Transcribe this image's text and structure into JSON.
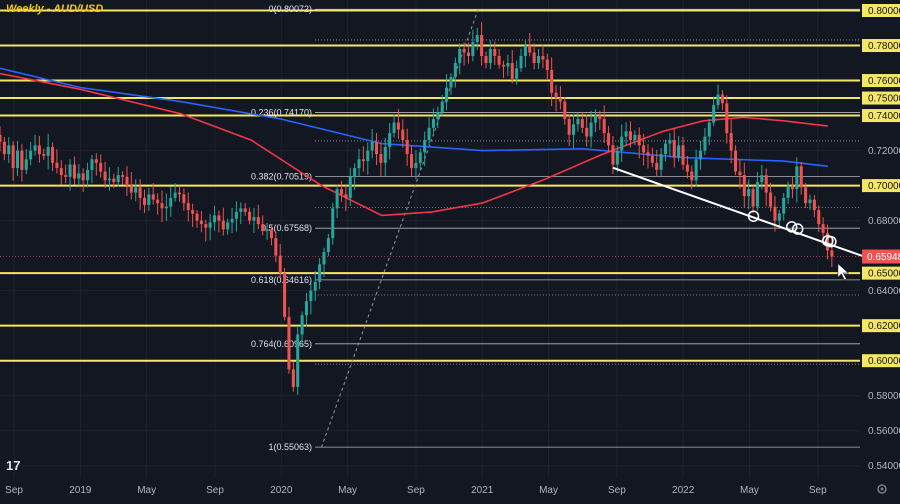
{
  "chart_data": {
    "type": "candlestick",
    "title": "Weekly - AUD/USD",
    "y_axis": {
      "ticks": [
        "0.80000",
        "0.78000",
        "0.76000",
        "0.75000",
        "0.74000",
        "0.72000",
        "0.70000",
        "0.68000",
        "0.65000",
        "0.64000",
        "0.62000",
        "0.60000",
        "0.58000",
        "0.56000",
        "0.54000"
      ],
      "tick_values": [
        0.8,
        0.78,
        0.76,
        0.75,
        0.74,
        0.72,
        0.7,
        0.68,
        0.65,
        0.64,
        0.62,
        0.6,
        0.58,
        0.56,
        0.54
      ],
      "range": [
        0.533,
        0.806
      ],
      "current_price_label": "0.65948",
      "current_price": 0.65948
    },
    "x_axis": {
      "ticks": [
        "Sep",
        "2019",
        "May",
        "Sep",
        "2020",
        "May",
        "Sep",
        "2021",
        "May",
        "Sep",
        "2022",
        "May",
        "Sep"
      ],
      "tick_dates": [
        2018.67,
        2019.0,
        2019.33,
        2019.67,
        2020.0,
        2020.33,
        2020.67,
        2021.0,
        2021.33,
        2021.67,
        2022.0,
        2022.33,
        2022.67
      ],
      "range": [
        2018.6,
        2022.88
      ]
    },
    "horizontal_levels": [
      0.8,
      0.78,
      0.76,
      0.75,
      0.74,
      0.7,
      0.65,
      0.62,
      0.6
    ],
    "level_color": "#f5e663",
    "fibonacci": [
      {
        "label": "0(0.80072)",
        "value": 0.80072
      },
      {
        "label": "0.236(0.74170)",
        "value": 0.7417
      },
      {
        "label": "0.382(0.70519)",
        "value": 0.70519
      },
      {
        "label": "0.5(0.67568)",
        "value": 0.67568
      },
      {
        "label": "0.618(0.64616)",
        "value": 0.64616
      },
      {
        "label": "0.764(0.60965)",
        "value": 0.60965
      },
      {
        "label": "1(0.55063)",
        "value": 0.55063
      }
    ],
    "dotted_levels": [
      0.7832,
      0.7255,
      0.6875,
      0.6375,
      0.598
    ],
    "moving_averages": [
      {
        "color": "#2962ff",
        "points": [
          [
            2018.6,
            0.767
          ],
          [
            2019.0,
            0.756
          ],
          [
            2019.5,
            0.748
          ],
          [
            2020.0,
            0.738
          ],
          [
            2020.5,
            0.724
          ],
          [
            2021.0,
            0.72
          ],
          [
            2021.5,
            0.721
          ],
          [
            2022.0,
            0.716
          ],
          [
            2022.5,
            0.714
          ],
          [
            2022.72,
            0.711
          ]
        ]
      },
      {
        "color": "#f23645",
        "points": [
          [
            2018.6,
            0.764
          ],
          [
            2019.0,
            0.755
          ],
          [
            2019.5,
            0.741
          ],
          [
            2019.85,
            0.726
          ],
          [
            2020.2,
            0.7
          ],
          [
            2020.5,
            0.683
          ],
          [
            2020.75,
            0.685
          ],
          [
            2021.0,
            0.69
          ],
          [
            2021.3,
            0.703
          ],
          [
            2021.6,
            0.718
          ],
          [
            2021.9,
            0.731
          ],
          [
            2022.1,
            0.737
          ],
          [
            2022.3,
            0.739
          ],
          [
            2022.5,
            0.737
          ],
          [
            2022.72,
            0.734
          ]
        ]
      }
    ],
    "trendline": {
      "color": "#ffffff",
      "points": [
        [
          2021.65,
          0.7102
        ],
        [
          2022.75,
          0.6618
        ]
      ],
      "touches": [
        [
          2022.35,
          0.6825
        ],
        [
          2022.54,
          0.6764
        ],
        [
          2022.57,
          0.6752
        ],
        [
          2022.72,
          0.6685
        ],
        [
          2022.735,
          0.668
        ]
      ]
    },
    "anchor_dashed": {
      "points": [
        [
          2020.2,
          0.5506
        ],
        [
          2020.98,
          0.8007
        ]
      ]
    },
    "candles_close": [
      0.725,
      0.718,
      0.723,
      0.71,
      0.72,
      0.709,
      0.715,
      0.72,
      0.723,
      0.718,
      0.717,
      0.722,
      0.713,
      0.71,
      0.706,
      0.705,
      0.712,
      0.704,
      0.707,
      0.703,
      0.709,
      0.715,
      0.713,
      0.708,
      0.703,
      0.704,
      0.702,
      0.706,
      0.705,
      0.7,
      0.696,
      0.699,
      0.693,
      0.689,
      0.695,
      0.692,
      0.69,
      0.687,
      0.688,
      0.693,
      0.696,
      0.695,
      0.69,
      0.686,
      0.684,
      0.68,
      0.678,
      0.676,
      0.679,
      0.683,
      0.68,
      0.675,
      0.679,
      0.681,
      0.685,
      0.687,
      0.685,
      0.68,
      0.682,
      0.678,
      0.674,
      0.675,
      0.67,
      0.66,
      0.65,
      0.625,
      0.595,
      0.585,
      0.615,
      0.626,
      0.634,
      0.64,
      0.645,
      0.655,
      0.662,
      0.67,
      0.687,
      0.698,
      0.695,
      0.693,
      0.705,
      0.71,
      0.715,
      0.714,
      0.72,
      0.725,
      0.718,
      0.713,
      0.722,
      0.73,
      0.736,
      0.732,
      0.726,
      0.718,
      0.71,
      0.713,
      0.719,
      0.726,
      0.733,
      0.738,
      0.742,
      0.748,
      0.756,
      0.762,
      0.77,
      0.778,
      0.776,
      0.774,
      0.782,
      0.786,
      0.774,
      0.77,
      0.778,
      0.774,
      0.769,
      0.768,
      0.77,
      0.761,
      0.767,
      0.774,
      0.78,
      0.776,
      0.77,
      0.774,
      0.772,
      0.766,
      0.753,
      0.75,
      0.748,
      0.738,
      0.729,
      0.735,
      0.738,
      0.733,
      0.728,
      0.736,
      0.74,
      0.738,
      0.73,
      0.723,
      0.712,
      0.72,
      0.728,
      0.731,
      0.726,
      0.729,
      0.723,
      0.719,
      0.717,
      0.713,
      0.709,
      0.718,
      0.724,
      0.726,
      0.716,
      0.723,
      0.712,
      0.708,
      0.703,
      0.715,
      0.72,
      0.728,
      0.736,
      0.746,
      0.752,
      0.747,
      0.73,
      0.72,
      0.708,
      0.706,
      0.694,
      0.698,
      0.688,
      0.702,
      0.706,
      0.696,
      0.688,
      0.68,
      0.684,
      0.693,
      0.7,
      0.698,
      0.711,
      0.699,
      0.69,
      0.692,
      0.686,
      0.678,
      0.673,
      0.663,
      0.6595
    ],
    "grid": true,
    "bull_color": "#26a69a",
    "bear_color": "#ef5350"
  }
}
